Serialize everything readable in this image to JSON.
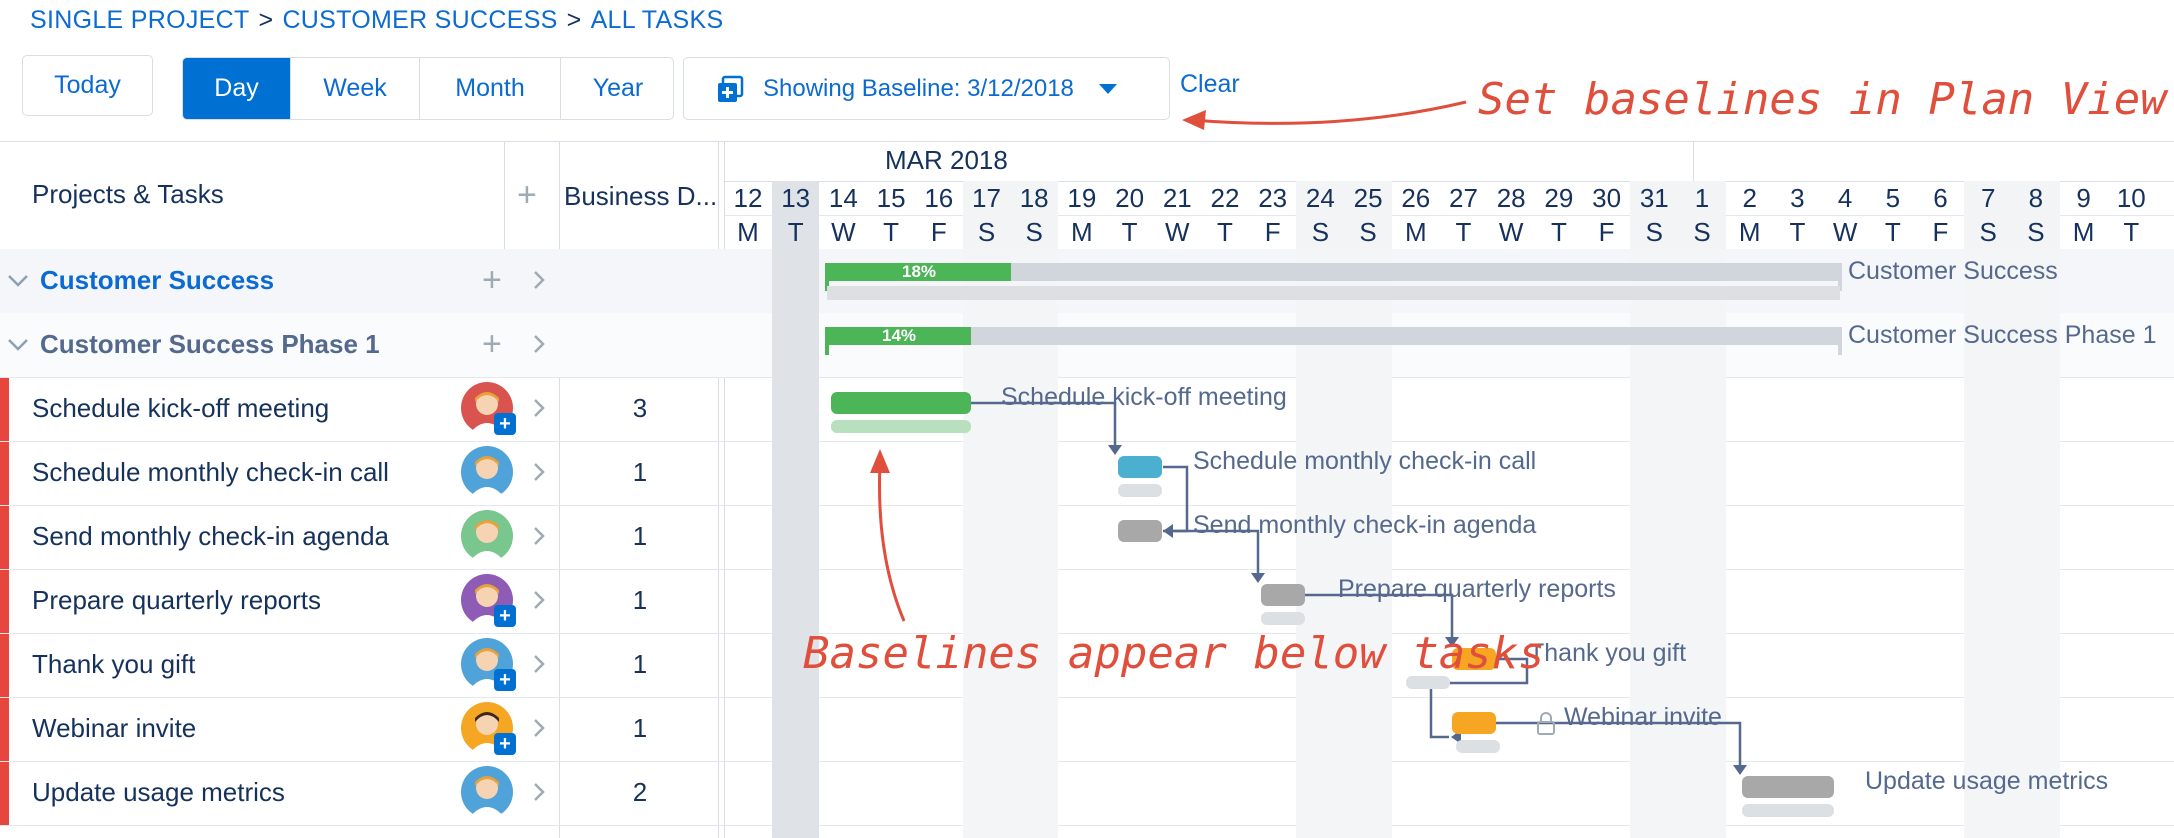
{
  "breadcrumb": {
    "items": [
      "SINGLE PROJECT",
      "CUSTOMER SUCCESS",
      "ALL TASKS"
    ],
    "separator": ">"
  },
  "toolbar": {
    "today": "Today",
    "views": [
      "Day",
      "Week",
      "Month",
      "Year"
    ],
    "active_view": "Day",
    "baseline": "Showing Baseline: 3/12/2018",
    "clear": "Clear"
  },
  "annotations": {
    "top": "Set baselines in Plan View",
    "middle": "Baselines appear below tasks"
  },
  "grid": {
    "col_tasks": "Projects & Tasks",
    "col_add": "+",
    "col_duration": "Business D..."
  },
  "timeline": {
    "month": "MAR 2018",
    "days": [
      "12",
      "13",
      "14",
      "15",
      "16",
      "17",
      "18",
      "19",
      "20",
      "21",
      "22",
      "23",
      "24",
      "25",
      "26",
      "27",
      "28",
      "29",
      "30",
      "31",
      "1",
      "2",
      "3",
      "4",
      "5",
      "6",
      "7",
      "8",
      "9",
      "10"
    ],
    "letters": [
      "M",
      "T",
      "W",
      "T",
      "F",
      "S",
      "S",
      "M",
      "T",
      "W",
      "T",
      "F",
      "S",
      "S",
      "M",
      "T",
      "W",
      "T",
      "F",
      "S",
      "S",
      "M",
      "T",
      "W",
      "T",
      "F",
      "S",
      "S",
      "M",
      "T"
    ]
  },
  "projects": [
    {
      "name": "Customer Success",
      "progress": "18%",
      "bar_label": "Customer Success"
    },
    {
      "name": "Customer Success Phase 1",
      "progress": "14%",
      "bar_label": "Customer Success Phase 1"
    }
  ],
  "tasks": [
    {
      "name": "Schedule kick-off meeting",
      "days": "3",
      "label": "Schedule kick-off meeting",
      "color": "#4bb557"
    },
    {
      "name": "Schedule monthly check-in call",
      "days": "1",
      "label": "Schedule monthly check-in call",
      "color": "#4bb0d0"
    },
    {
      "name": "Send monthly check-in agenda",
      "days": "1",
      "label": "Send monthly check-in agenda",
      "color": "#a8a8a8"
    },
    {
      "name": "Prepare quarterly reports",
      "days": "1",
      "label": "Prepare quarterly reports",
      "color": "#a8a8a8"
    },
    {
      "name": "Thank you gift",
      "days": "1",
      "label": "Thank you gift",
      "color": "#f7a623"
    },
    {
      "name": "Webinar invite",
      "days": "1",
      "label": "Webinar invite",
      "color": "#f7a623"
    },
    {
      "name": "Update usage metrics",
      "days": "2",
      "label": "Update usage metrics",
      "color": "#a8a8a8"
    }
  ],
  "colors": {
    "accent": "#0070d2",
    "annotation": "#e04e3c",
    "progress": "#4bb557",
    "baseline": "#dde0e3"
  },
  "icons": [
    "calendar-baseline-icon",
    "caret-down-icon",
    "plus-icon",
    "chevron-right-icon",
    "chevron-down-icon",
    "lock-icon"
  ]
}
